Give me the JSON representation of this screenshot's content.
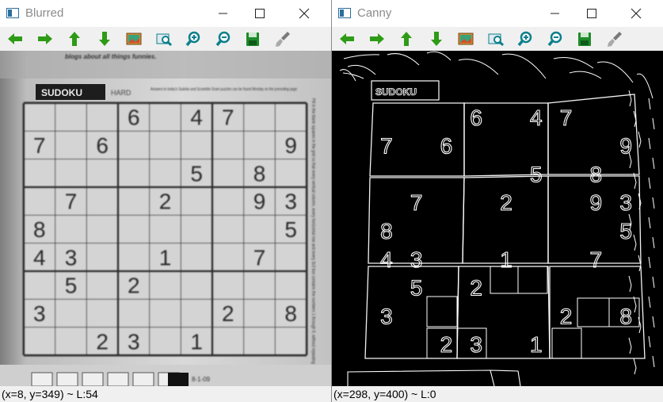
{
  "windows": {
    "left": {
      "title": "Blurred",
      "status": "(x=8, y=349) ~ L:54",
      "tools": [
        "pan-left",
        "pan-right",
        "pan-up",
        "pan-down",
        "zoom-in",
        "zoom-out",
        "save",
        "settings"
      ]
    },
    "right": {
      "title": "Canny",
      "status": "(x=298, y=400) ~ L:0"
    }
  },
  "toolbar": {
    "buttons": [
      {
        "name": "pan-left-button",
        "icon": "arrow-left-icon"
      },
      {
        "name": "pan-right-button",
        "icon": "arrow-right-icon"
      },
      {
        "name": "pan-up-button",
        "icon": "arrow-up-icon"
      },
      {
        "name": "pan-down-button",
        "icon": "arrow-down-icon"
      },
      {
        "name": "zoom-fit-button",
        "icon": "image-icon"
      },
      {
        "name": "zoom-100-button",
        "icon": "zoom-100-icon"
      },
      {
        "name": "zoom-in-button",
        "icon": "zoom-in-icon"
      },
      {
        "name": "zoom-out-button",
        "icon": "zoom-out-icon"
      },
      {
        "name": "save-image-button",
        "icon": "save-icon"
      },
      {
        "name": "properties-button",
        "icon": "brush-icon"
      }
    ]
  },
  "newspaper": {
    "header": "SUDOKU",
    "difficulty": "HARD",
    "promo": "blogs about all things funnies.",
    "intro": "Answers to today's Sudoku and Scramble Gram puzzles can be found Monday on the preceding page",
    "rules": "Fill in the blank squares in the grid so that every vertical column, every horizontal row and every 3x3 box contains the numbers 1 through 9, without repeating any.",
    "date": "8-1-09"
  },
  "sudoku": {
    "givens": [
      {
        "r": 0,
        "c": 3,
        "v": "6"
      },
      {
        "r": 0,
        "c": 5,
        "v": "4"
      },
      {
        "r": 0,
        "c": 6,
        "v": "7"
      },
      {
        "r": 1,
        "c": 0,
        "v": "7"
      },
      {
        "r": 1,
        "c": 2,
        "v": "6"
      },
      {
        "r": 1,
        "c": 8,
        "v": "9"
      },
      {
        "r": 2,
        "c": 5,
        "v": "5"
      },
      {
        "r": 2,
        "c": 7,
        "v": "8"
      },
      {
        "r": 3,
        "c": 1,
        "v": "7"
      },
      {
        "r": 3,
        "c": 4,
        "v": "2"
      },
      {
        "r": 3,
        "c": 7,
        "v": "9"
      },
      {
        "r": 3,
        "c": 8,
        "v": "3"
      },
      {
        "r": 4,
        "c": 0,
        "v": "8"
      },
      {
        "r": 4,
        "c": 8,
        "v": "5"
      },
      {
        "r": 5,
        "c": 0,
        "v": "4"
      },
      {
        "r": 5,
        "c": 1,
        "v": "3"
      },
      {
        "r": 5,
        "c": 4,
        "v": "1"
      },
      {
        "r": 5,
        "c": 7,
        "v": "7"
      },
      {
        "r": 6,
        "c": 1,
        "v": "5"
      },
      {
        "r": 6,
        "c": 3,
        "v": "2"
      },
      {
        "r": 7,
        "c": 0,
        "v": "3"
      },
      {
        "r": 7,
        "c": 6,
        "v": "2"
      },
      {
        "r": 7,
        "c": 8,
        "v": "8"
      },
      {
        "r": 8,
        "c": 2,
        "v": "2"
      },
      {
        "r": 8,
        "c": 3,
        "v": "3"
      },
      {
        "r": 8,
        "c": 5,
        "v": "1"
      }
    ]
  },
  "colors": {
    "arrow": "#2e9b16",
    "magnifier": "#0c7f8c",
    "save": "#1e8a2a",
    "title_inactive": "#8b8b8b",
    "toolbar_bg": "#f0f0f0"
  }
}
